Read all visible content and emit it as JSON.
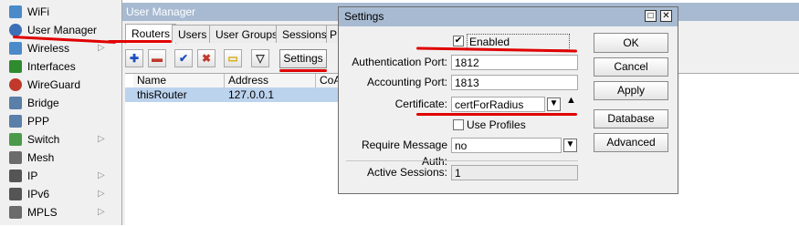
{
  "sidebar": {
    "items": [
      {
        "label": "WiFi",
        "has_submenu": false,
        "icon": "wifi-icon",
        "color": "#4a8ac9"
      },
      {
        "label": "User Manager",
        "has_submenu": false,
        "icon": "users-icon",
        "color": "#3b6fb6"
      },
      {
        "label": "Wireless",
        "has_submenu": true,
        "icon": "wireless-icon",
        "color": "#4a8ac9"
      },
      {
        "label": "Interfaces",
        "has_submenu": false,
        "icon": "interfaces-icon",
        "color": "#2e8b2e"
      },
      {
        "label": "WireGuard",
        "has_submenu": false,
        "icon": "wireguard-icon",
        "color": "#c0392b"
      },
      {
        "label": "Bridge",
        "has_submenu": false,
        "icon": "bridge-icon",
        "color": "#5a7fa8"
      },
      {
        "label": "PPP",
        "has_submenu": false,
        "icon": "ppp-icon",
        "color": "#5a7fa8"
      },
      {
        "label": "Switch",
        "has_submenu": true,
        "icon": "switch-icon",
        "color": "#4b9a4b"
      },
      {
        "label": "Mesh",
        "has_submenu": false,
        "icon": "mesh-icon",
        "color": "#6b6b6b"
      },
      {
        "label": "IP",
        "has_submenu": true,
        "icon": "ip-icon",
        "color": "#555555"
      },
      {
        "label": "IPv6",
        "has_submenu": true,
        "icon": "ipv6-icon",
        "color": "#555555"
      },
      {
        "label": "MPLS",
        "has_submenu": true,
        "icon": "mpls-icon",
        "color": "#6b6b6b"
      }
    ]
  },
  "user_manager": {
    "title": "User Manager",
    "tabs": [
      {
        "label": "Routers",
        "active": true
      },
      {
        "label": "Users",
        "active": false
      },
      {
        "label": "User Groups",
        "active": false
      },
      {
        "label": "Sessions",
        "active": false
      },
      {
        "label": "P",
        "active": false
      }
    ],
    "toolbar": {
      "settings_label": "Settings"
    },
    "columns": [
      "Name",
      "Address",
      "CoA"
    ],
    "rows": [
      {
        "name": "thisRouter",
        "address": "127.0.0.1",
        "coa": ""
      }
    ]
  },
  "settings_dialog": {
    "title": "Settings",
    "enabled_label": "Enabled",
    "enabled_checked": true,
    "auth_port_label": "Authentication Port:",
    "auth_port_value": "1812",
    "acct_port_label": "Accounting Port:",
    "acct_port_value": "1813",
    "certificate_label": "Certificate:",
    "certificate_value": "certForRadius",
    "use_profiles_label": "Use Profiles",
    "use_profiles_checked": false,
    "require_msg_auth_label": "Require Message Auth:",
    "require_msg_auth_value": "no",
    "active_sessions_label": "Active Sessions:",
    "active_sessions_value": "1",
    "buttons": {
      "ok": "OK",
      "cancel": "Cancel",
      "apply": "Apply",
      "database": "Database",
      "advanced": "Advanced"
    }
  },
  "colors": {
    "titlebar": "#a7bad1",
    "annotation_red": "#e00000",
    "selected_row": "#bcd3ee"
  }
}
